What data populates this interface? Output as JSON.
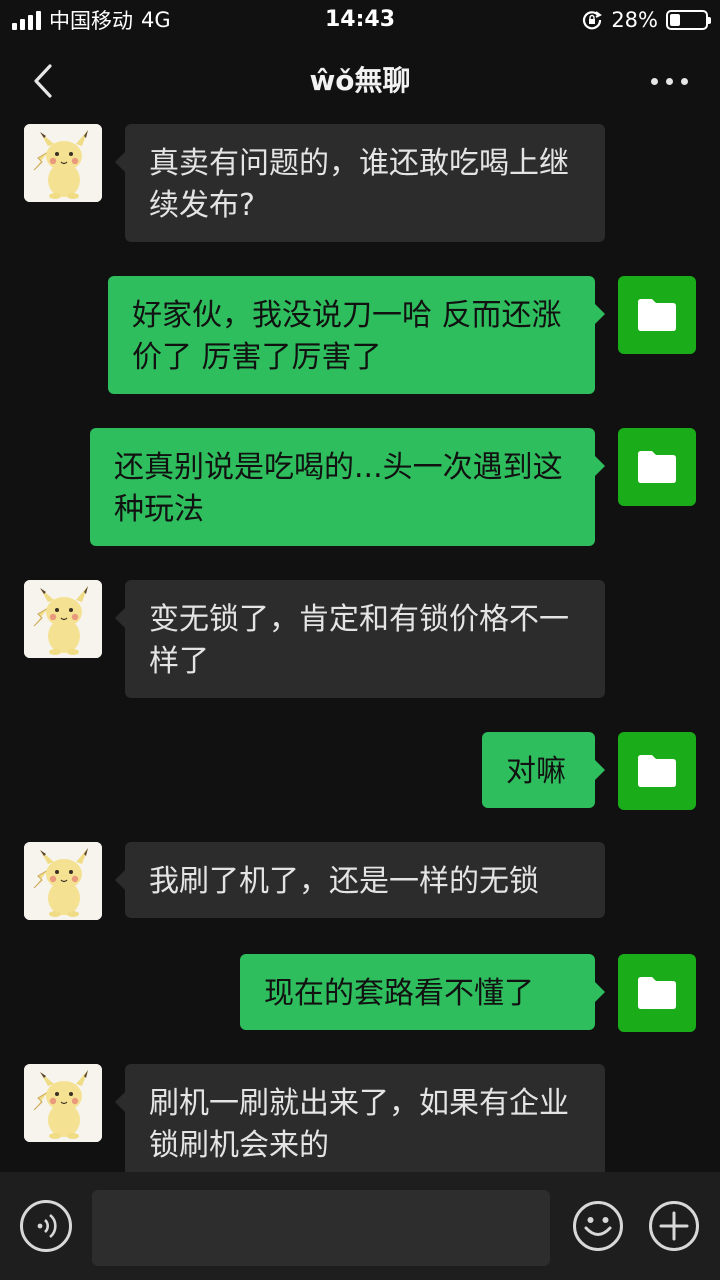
{
  "status_bar": {
    "carrier": "中国移动",
    "network": "4G",
    "time": "14:43",
    "battery_percent": "28%",
    "battery_level": 0.28
  },
  "nav": {
    "title": "ŵǒ無聊",
    "back_icon": "chevron-left-icon",
    "more_icon": "more-dots-icon"
  },
  "messages": [
    {
      "side": "in",
      "text": "真卖有问题的，谁还敢吃喝上继续发布?"
    },
    {
      "side": "out",
      "text": "好家伙，我没说刀一哈 反而还涨价了 厉害了厉害了"
    },
    {
      "side": "out",
      "text": "还真别说是吃喝的...头一次遇到这种玩法"
    },
    {
      "side": "in",
      "text": "变无锁了，肯定和有锁价格不一样了"
    },
    {
      "side": "out",
      "text": "对嘛"
    },
    {
      "side": "in",
      "text": "我刷了机了，还是一样的无锁"
    },
    {
      "side": "out",
      "text": "现在的套路看不懂了"
    },
    {
      "side": "in",
      "text": "刷机一刷就出来了，如果有企业锁刷机会来的"
    }
  ],
  "input_bar": {
    "voice_icon": "voice-icon",
    "input_value": "",
    "emoji_icon": "emoji-icon",
    "plus_icon": "plus-icon"
  },
  "colors": {
    "background": "#111111",
    "incoming_bubble": "#2c2c2c",
    "outgoing_bubble": "#2fbe5d",
    "file_avatar": "#1aad19"
  }
}
